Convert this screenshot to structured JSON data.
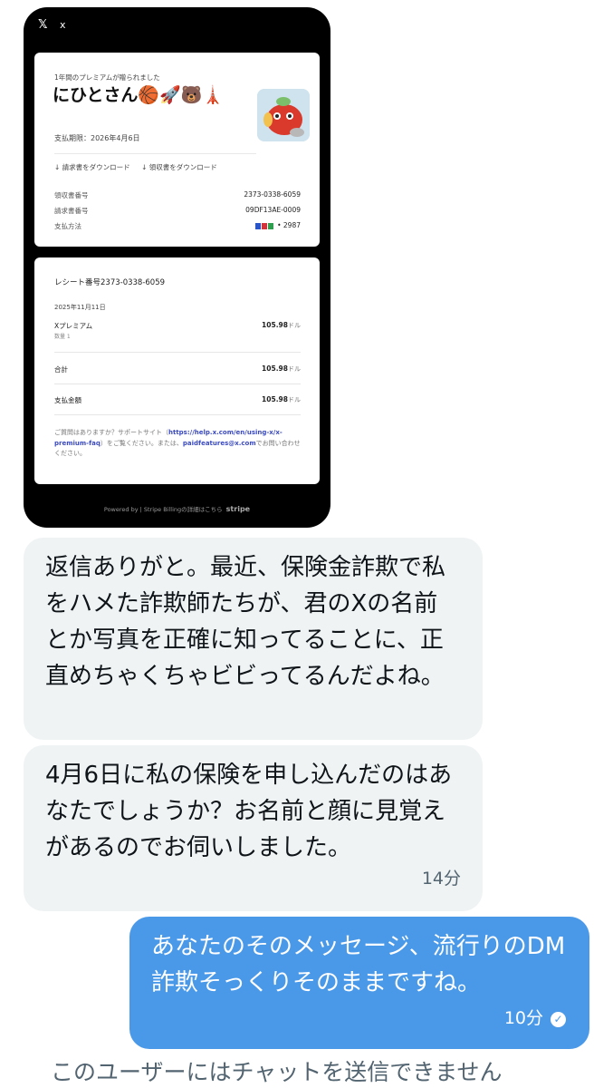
{
  "shot": {
    "top_logo": "𝕏",
    "top_close": "x",
    "card1": {
      "subtitle": "1年間のプレミアムが贈られました",
      "name": "にひとさん🏀🚀🐻🗼",
      "due": "支払期限：2026年4月6日",
      "download_invoice": "↓ 請求書をダウンロード",
      "download_receipt": "↓ 領収書をダウンロード",
      "rows": [
        {
          "label": "領収書番号",
          "value": "2373-0338-6059"
        },
        {
          "label": "請求書番号",
          "value": "09DF13AE-0009"
        },
        {
          "label": "支払方法",
          "value": "• 2987"
        }
      ]
    },
    "card2": {
      "title": "レシート番号2373-0338-6059",
      "date": "2025年11月11日",
      "item_label": "Xプレミアム",
      "item_amount": "105.98",
      "item_qty": "数量 1",
      "total_label": "合計",
      "total_amount": "105.98",
      "paid_label": "支払金額",
      "paid_amount": "105.98",
      "currency": "ドル",
      "help_prefix": "ご質問はありますか？サポートサイト（",
      "help_link": "https://help.x.com/en/using-x/x-premium-faq",
      "help_middle": "）をご覧ください。または、",
      "help_email": "paidfeatures@x.com",
      "help_suffix": "でお問い合わせください。"
    },
    "powered": "Powered by  |  Stripe Billingの詳細はこちら",
    "stripe": "stripe"
  },
  "messages": [
    {
      "direction": "incoming",
      "text": "返信ありがと。最近、保険金詐欺で私をハメた詐欺師たちが、君のXの名前とか写真を正確に知ってることに、正直めちゃくちゃビビってるんだよね。",
      "time": ""
    },
    {
      "direction": "incoming",
      "text": "4月6日に私の保険を申し込んだのはあなたでしょうか？お名前と顔に見覚えがあるのでお伺いしました。",
      "time": "14分"
    },
    {
      "direction": "outgoing",
      "text": "あなたのそのメッセージ、流行りのDM詐欺そっくりそのままですね。",
      "time": "10分"
    }
  ],
  "footer_note": "このユーザーにはチャットを送信できません",
  "colors": {
    "outgoing_bubble": "#4a99e9",
    "incoming_bubble": "#eff3f4",
    "frame": "#000000"
  }
}
